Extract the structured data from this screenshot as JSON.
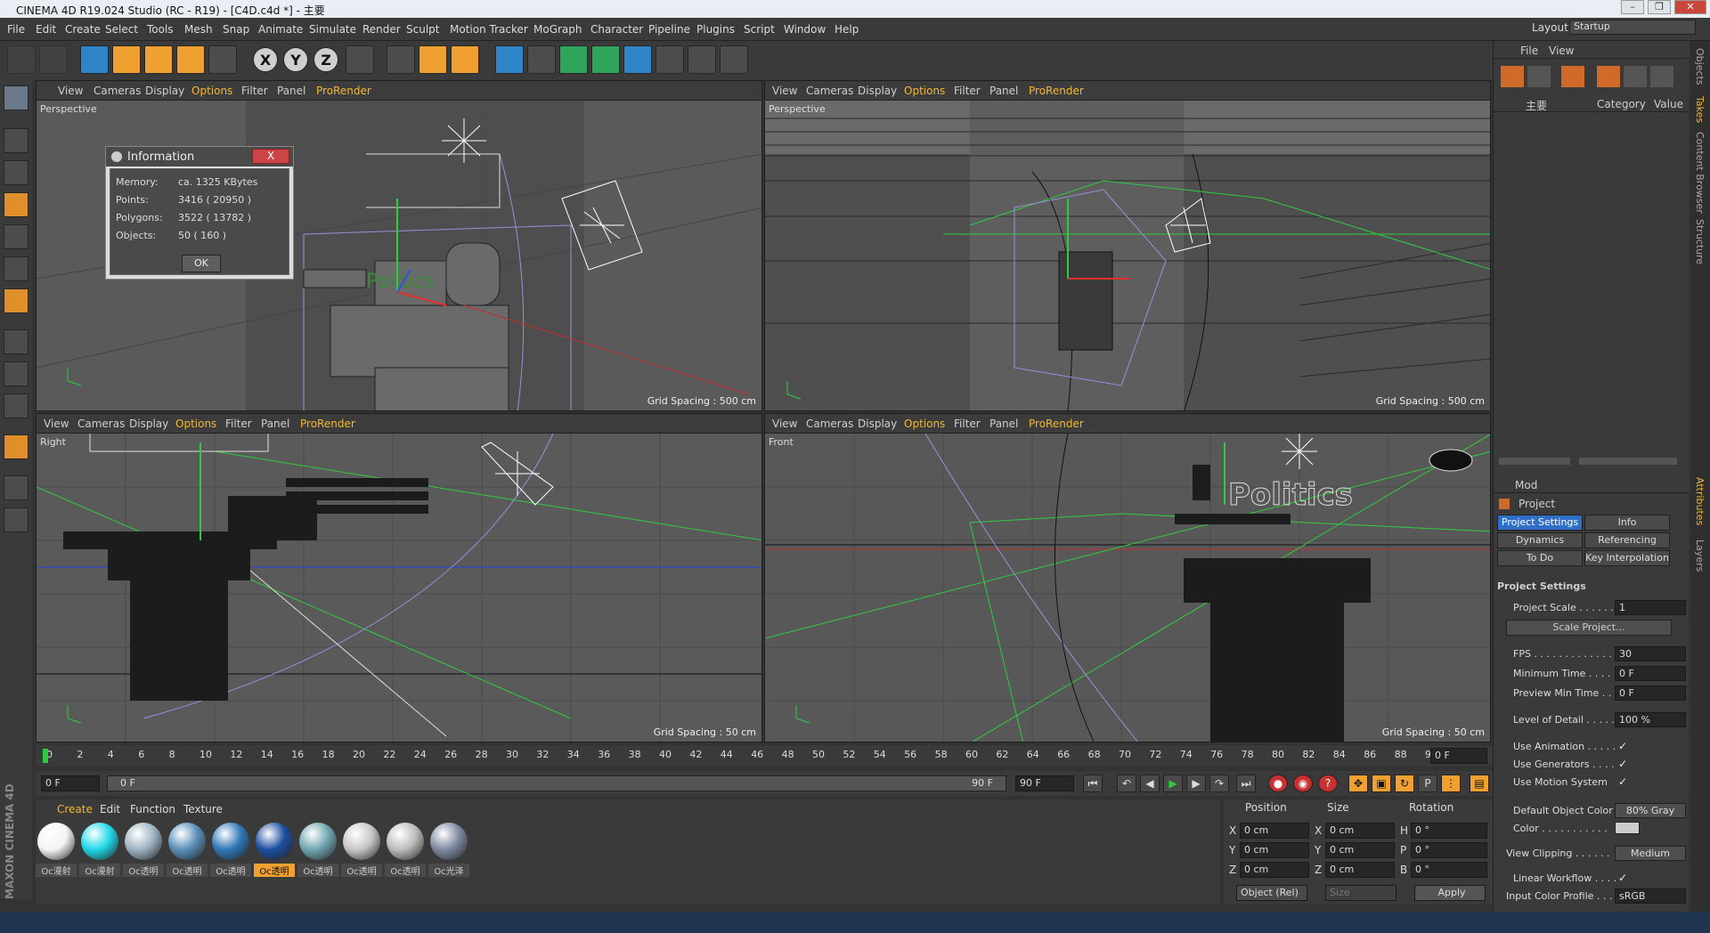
{
  "window": {
    "title": "CINEMA 4D R19.024 Studio (RC - R19) - [C4D.c4d *] - 主要"
  },
  "menubar": {
    "items": [
      "File",
      "Edit",
      "Create",
      "Select",
      "Tools",
      "Mesh",
      "Snap",
      "Animate",
      "Simulate",
      "Render",
      "Sculpt",
      "Motion Tracker",
      "MoGraph",
      "Character",
      "Pipeline",
      "Plugins",
      "Script",
      "Window",
      "Help"
    ],
    "layout_label": "Layout:",
    "layout_value": "Startup"
  },
  "toolbar": {
    "axis_x": "X",
    "axis_y": "Y",
    "axis_z": "Z"
  },
  "viewport_menu": {
    "view": "View",
    "cameras": "Cameras",
    "display": "Display",
    "options": "Options",
    "filter": "Filter",
    "panel": "Panel",
    "prorender": "ProRender"
  },
  "viewports": {
    "top_left": {
      "name": "Perspective",
      "grid": "Grid Spacing : 500 cm"
    },
    "top_right": {
      "name": "Perspective",
      "grid": "Grid Spacing : 500 cm"
    },
    "bottom_left": {
      "name": "Right",
      "grid": "Grid Spacing : 50 cm"
    },
    "bottom_right": {
      "name": "Front",
      "grid": "Grid Spacing : 50 cm"
    }
  },
  "scene": {
    "text_object": "Politics"
  },
  "info_dialog": {
    "title": "Information",
    "close": "X",
    "memory_label": "Memory:",
    "memory_value": "ca. 1325 KBytes",
    "points_label": "Points:",
    "points_value": "3416 ( 20950 )",
    "polygons_label": "Polygons:",
    "polygons_value": "3522 ( 13782 )",
    "objects_label": "Objects:",
    "objects_value": "50 ( 160 )",
    "ok": "OK"
  },
  "timeline": {
    "ticks": [
      "0",
      "2",
      "4",
      "6",
      "8",
      "10",
      "12",
      "14",
      "16",
      "18",
      "20",
      "22",
      "24",
      "26",
      "28",
      "30",
      "32",
      "34",
      "36",
      "38",
      "40",
      "42",
      "44",
      "46",
      "48",
      "50",
      "52",
      "54",
      "56",
      "58",
      "60",
      "62",
      "64",
      "66",
      "68",
      "70",
      "72",
      "74",
      "76",
      "78",
      "80",
      "82",
      "84",
      "86",
      "88",
      "90"
    ],
    "current_frame": "0 F"
  },
  "playbar": {
    "start": "0 F",
    "range_start": "0 F",
    "range_end": "90 F",
    "end": "90 F"
  },
  "materials": {
    "tabs": [
      "Create",
      "Edit",
      "Function",
      "Texture"
    ],
    "items": [
      {
        "label": "Oc漫射",
        "color": "#f4f4f4"
      },
      {
        "label": "Oc漫射",
        "color": "#20d8e8"
      },
      {
        "label": "Oc透明",
        "color": "#9fb4c2"
      },
      {
        "label": "Oc透明",
        "color": "#5a8fb8"
      },
      {
        "label": "Oc透明",
        "color": "#2f78b6"
      },
      {
        "label": "Oc透明",
        "color": "#1c4fa0"
      },
      {
        "label": "Oc透明",
        "color": "#6fa6b0"
      },
      {
        "label": "Oc透明",
        "color": "#c8c8c8"
      },
      {
        "label": "Oc透明",
        "color": "#bdbdbd"
      },
      {
        "label": "Oc光泽",
        "color": "#7e8aa0"
      }
    ]
  },
  "coords": {
    "position": "Position",
    "size": "Size",
    "rotation": "Rotation",
    "x": "X",
    "y": "Y",
    "z": "Z",
    "h": "H",
    "p": "P",
    "b": "B",
    "px": "0 cm",
    "py": "0 cm",
    "pz": "0 cm",
    "sx": "0 cm",
    "sy": "0 cm",
    "sz": "0 cm",
    "rh": "0 °",
    "rp": "0 °",
    "rb": "0 °",
    "mode": "Object (Rel)",
    "size_mode": "Size",
    "apply": "Apply"
  },
  "objects_panel": {
    "file": "File",
    "view": "View",
    "take": "主要",
    "category": "Category",
    "value": "Value"
  },
  "attributes": {
    "mode": "Mod",
    "object": "Project",
    "tabs": [
      "Project Settings",
      "Info",
      "Dynamics",
      "Referencing",
      "To Do",
      "Key Interpolation"
    ],
    "section": "Project Settings",
    "rows": [
      {
        "label": "Project Scale . . . . . .",
        "value": "1"
      },
      {
        "label": "FPS . . . . . . . . . . . . .",
        "value": "30"
      },
      {
        "label": "Minimum Time . . . . .",
        "value": "0 F"
      },
      {
        "label": "Preview Min Time . . .",
        "value": "0 F"
      },
      {
        "label": "Level of Detail . . . . .",
        "value": "100 %"
      }
    ],
    "scale_button": "Scale Project...",
    "checks": [
      {
        "label": "Use Animation . . . . .",
        "mark": "✓"
      },
      {
        "label": "Use Generators . . . .",
        "mark": "✓"
      },
      {
        "label": "Use Motion System",
        "mark": "✓"
      }
    ],
    "default_color_label": "Default Object Color",
    "default_color_value": "80% Gray",
    "color_label": "Color . . . . . . . . . . .",
    "clipping_label": "View Clipping . . . . . .",
    "clipping_value": "Medium",
    "linear_label": "Linear Workflow . . . .",
    "linear_mark": "✓",
    "profile_label": "Input Color Profile . . .",
    "profile_value": "sRGB"
  },
  "side_tabs": [
    "Objects",
    "Takes",
    "Content Browser",
    "Structure",
    "Attributes",
    "Layers"
  ],
  "brand": "MAXON CINEMA 4D"
}
